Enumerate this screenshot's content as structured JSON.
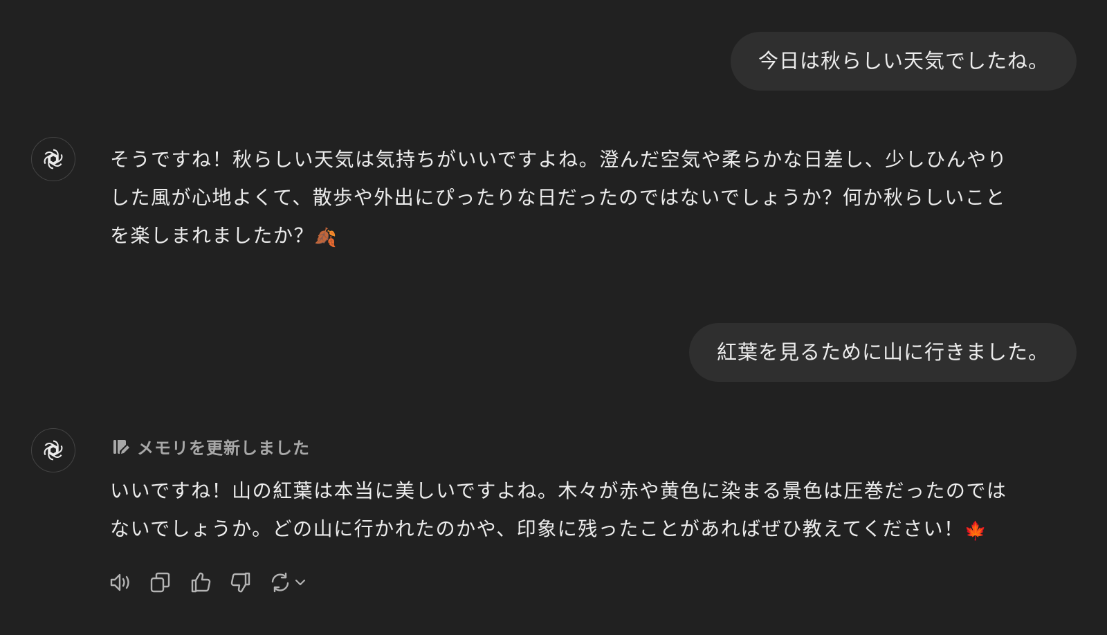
{
  "messages": {
    "user_1": "今日は秋らしい天気でしたね。",
    "assistant_1": {
      "line_1": "そうですね！秋らしい天気は気持ちがいいですよね。澄んだ空気や柔らかな日差し、少しひんやり",
      "line_2": "した風が心地よくて、散歩や外出にぴったりな日だったのではないでしょうか？何か秋らしいこと",
      "line_3": "を楽しまれましたか？",
      "emoji": "🍂"
    },
    "user_2": "紅葉を見るために山に行きました。",
    "assistant_2": {
      "memory_note": "メモリを更新しました",
      "line_1": "いいですね！山の紅葉は本当に美しいですよね。木々が赤や黄色に染まる景色は圧巻だったのでは",
      "line_2": "ないでしょうか。どの山に行かれたのかや、印象に残ったことがあればぜひ教えてください！",
      "emoji": "🍁"
    }
  },
  "icons": {
    "avatar": "openai-logo-icon",
    "memory": "memory-edit-icon",
    "actions": [
      "speaker-icon",
      "copy-icon",
      "thumbs-up-icon",
      "thumbs-down-icon",
      "regenerate-icon",
      "chevron-down-icon"
    ]
  },
  "colors": {
    "background": "#212121",
    "user_bubble": "#2f2f2f",
    "text": "#ececec",
    "muted": "#a8a8a8"
  }
}
